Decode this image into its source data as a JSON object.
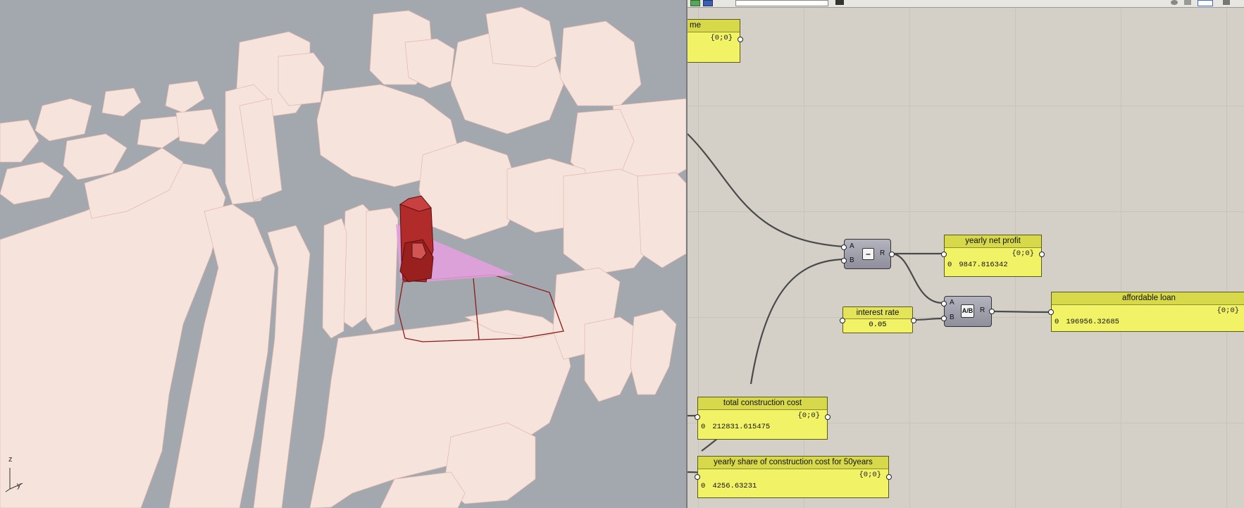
{
  "viewport": {
    "axis_labels": {
      "z": "z",
      "y": "y"
    }
  },
  "canvas": {
    "top_panel": {
      "title": "me",
      "path": "{0;0}"
    },
    "subtract": {
      "input_a": "A",
      "input_b": "B",
      "output": "R",
      "symbol": "–"
    },
    "divide": {
      "input_a": "A",
      "input_b": "B",
      "output": "R",
      "symbol": "A/B"
    },
    "yearly_net_profit": {
      "title": "yearly net profit",
      "path": "{0;0}",
      "index": "0",
      "value": "9847.816342"
    },
    "affordable_loan": {
      "title": "affordable loan",
      "path": "{0;0}",
      "index": "0",
      "value": "196956.32685"
    },
    "interest_rate": {
      "title": "interest rate",
      "value": "0.05"
    },
    "total_construction_cost": {
      "title": "total construction cost",
      "path": "{0;0}",
      "index": "0",
      "value": "212831.615475"
    },
    "yearly_share": {
      "title": "yearly share of construction cost for 50years",
      "path": "{0;0}",
      "index": "0",
      "value": "4256.63231"
    }
  },
  "colors": {
    "panel_yellow": "#f2f266",
    "building_fill": "#f6e3dc",
    "selected_red": "#b22b2b",
    "site_pink": "#e8a0e0",
    "viewport_bg": "#a3a8ae",
    "canvas_bg": "#d4d0c8"
  }
}
